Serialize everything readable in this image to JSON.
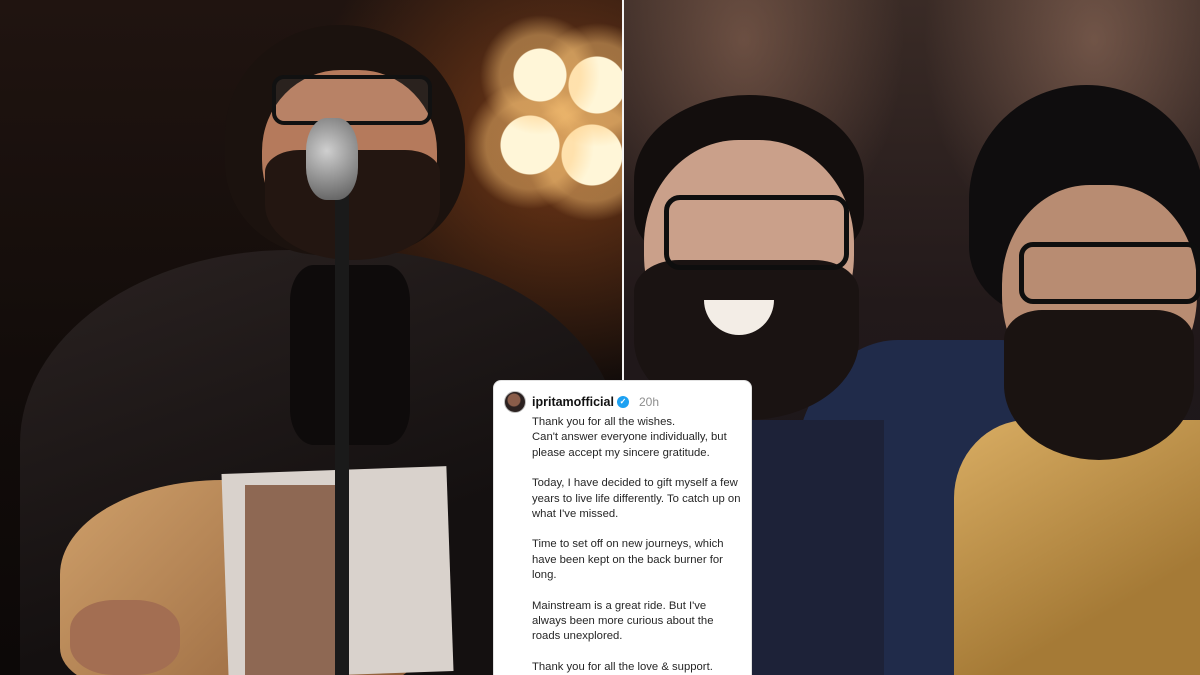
{
  "post": {
    "username": "ipritamofficial",
    "verified_icon": "verified-badge-icon",
    "time_ago": "20h",
    "paragraphs": [
      "Thank you for all the wishes.\nCan't answer everyone individually, but please accept my sincere gratitude.",
      "Today, I have decided to gift myself a few years to live life differently. To catch up on what I've missed.",
      "Time to set off on new journeys, which have been kept on the back burner for long.",
      "Mainstream is a great ride. But I've always been more curious about the roads unexplored.",
      "Thank you for all the love & support.\nAlways...."
    ],
    "closing_icon": "heart-icon",
    "heart_color": "#e0457b"
  },
  "colors": {
    "card_background": "#ffffff",
    "verified_blue": "#1da1f2"
  }
}
